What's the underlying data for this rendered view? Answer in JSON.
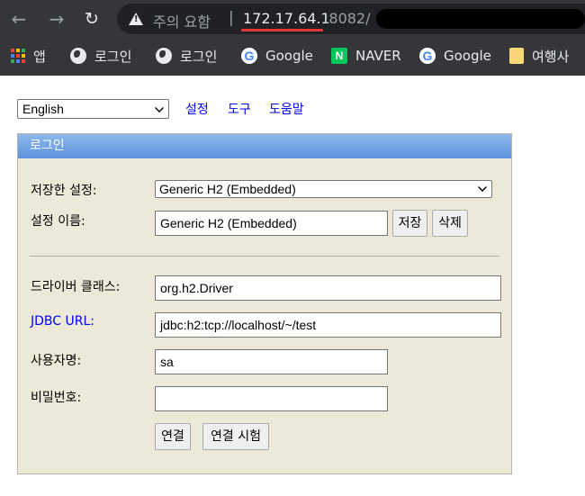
{
  "browser": {
    "security_label": "주의 요함",
    "separator": "|",
    "url_host": "172.17.64.1",
    "url_port": ":8082/",
    "bookmarks": [
      {
        "label": "앱",
        "icon": "apps-grid-icon"
      },
      {
        "label": "로그인",
        "icon": "globe-icon"
      },
      {
        "label": "로그인",
        "icon": "globe-icon"
      },
      {
        "label": "Google",
        "icon": "google-icon"
      },
      {
        "label": "NAVER",
        "icon": "naver-icon"
      },
      {
        "label": "Google",
        "icon": "google-icon"
      },
      {
        "label": "여행사",
        "icon": "folder-icon"
      }
    ]
  },
  "top": {
    "language": "English",
    "links": [
      "설정",
      "도구",
      "도움말"
    ]
  },
  "login": {
    "title": "로그인",
    "saved_settings_label": "저장한 설정:",
    "saved_settings_value": "Generic H2 (Embedded)",
    "setting_name_label": "설정 이름:",
    "setting_name_value": "Generic H2 (Embedded)",
    "save_button": "저장",
    "delete_button": "삭제",
    "driver_label": "드라이버 클래스:",
    "driver_value": "org.h2.Driver",
    "jdbc_label": "JDBC URL:",
    "jdbc_value": "jdbc:h2:tcp://localhost/~/test",
    "username_label": "사용자명:",
    "username_value": "sa",
    "password_label": "비밀번호:",
    "password_value": "",
    "connect_button": "연결",
    "test_button": "연결 시험"
  }
}
